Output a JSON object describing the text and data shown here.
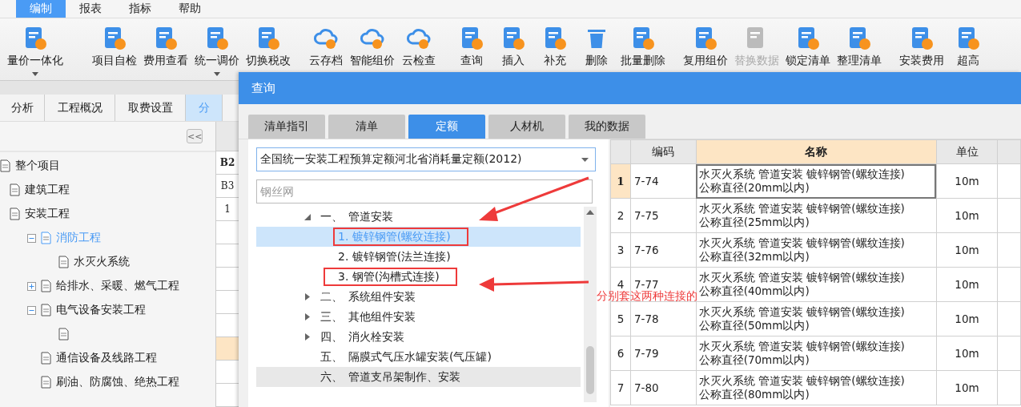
{
  "menu": [
    {
      "label": "编制",
      "selected": true
    },
    {
      "label": "报表",
      "selected": false
    },
    {
      "label": "指标",
      "selected": false
    },
    {
      "label": "帮助",
      "selected": false
    }
  ],
  "toolbar": [
    {
      "label": "量价一体化",
      "has_menu": true,
      "disabled": false
    },
    {
      "label": "项目自检",
      "has_menu": false,
      "disabled": false
    },
    {
      "label": "费用查看",
      "has_menu": false,
      "disabled": false
    },
    {
      "label": "统一调价",
      "has_menu": true,
      "disabled": false
    },
    {
      "label": "切换税改",
      "has_menu": false,
      "disabled": false
    },
    {
      "label": "云存档",
      "has_menu": false,
      "disabled": false
    },
    {
      "label": "智能组价",
      "has_menu": false,
      "disabled": false
    },
    {
      "label": "云检查",
      "has_menu": false,
      "disabled": false
    },
    {
      "label": "查询",
      "has_menu": false,
      "disabled": false
    },
    {
      "label": "插入",
      "has_menu": false,
      "disabled": false
    },
    {
      "label": "补充",
      "has_menu": false,
      "disabled": false
    },
    {
      "label": "删除",
      "has_menu": false,
      "disabled": false
    },
    {
      "label": "批量删除",
      "has_menu": false,
      "disabled": false
    },
    {
      "label": "复用组价",
      "has_menu": false,
      "disabled": false
    },
    {
      "label": "替换数据",
      "has_menu": false,
      "disabled": true
    },
    {
      "label": "锁定清单",
      "has_menu": false,
      "disabled": false
    },
    {
      "label": "整理清单",
      "has_menu": false,
      "disabled": false
    },
    {
      "label": "安装费用",
      "has_menu": false,
      "disabled": false
    },
    {
      "label": "超高",
      "has_menu": false,
      "disabled": false
    }
  ],
  "main_tabs": [
    {
      "label": "分析",
      "selected": false
    },
    {
      "label": "工程概况",
      "selected": false
    },
    {
      "label": "取费设置",
      "selected": false
    },
    {
      "label": "分",
      "selected": true
    }
  ],
  "collapse_button": "<<",
  "project_tree": [
    {
      "label": "整个项目",
      "selected": false,
      "children": [
        {
          "label": "建筑工程",
          "selected": false
        },
        {
          "label": "安装工程",
          "selected": false,
          "children": [
            {
              "label": "消防工程",
              "selected": true,
              "expanded": true,
              "children": [
                {
                  "label": "水灭火系统",
                  "selected": false
                }
              ]
            },
            {
              "label": "给排水、采暖、燃气工程",
              "selected": false,
              "expanded": false
            },
            {
              "label": "电气设备安装工程",
              "selected": false,
              "expanded": true,
              "children": [
                {
                  "selected": false
                }
              ]
            },
            {
              "label": "通信设备及线路工程",
              "selected": false
            },
            {
              "label": "刷油、防腐蚀、绝热工程",
              "selected": false
            }
          ]
        }
      ]
    }
  ],
  "side_column": [
    {
      "text": "B2",
      "bold": true
    },
    {
      "text": "B3",
      "bold": false
    },
    {
      "text": "1",
      "bold": false
    }
  ],
  "dialog": {
    "title": "查询",
    "tabs": [
      {
        "label": "清单指引",
        "selected": false
      },
      {
        "label": "清单",
        "selected": false
      },
      {
        "label": "定额",
        "selected": true
      },
      {
        "label": "人材机",
        "selected": false
      },
      {
        "label": "我的数据",
        "selected": false
      }
    ],
    "library": "全国统一安装工程预算定额河北省消耗量定额(2012)",
    "search": {
      "placeholder": "钢丝网"
    },
    "tree": [
      {
        "number": "一、",
        "label": "管道安装",
        "expanded": true,
        "hovered": false,
        "children": [
          {
            "label": "1. 镀锌钢管(螺纹连接)",
            "selected": true,
            "boxed": true
          },
          {
            "label": "2. 镀锌钢管(法兰连接)",
            "selected": false,
            "boxed": false
          },
          {
            "label": "3. 钢管(沟槽式连接)",
            "selected": false,
            "boxed": true
          }
        ]
      },
      {
        "number": "二、",
        "label": "系统组件安装",
        "expanded": false,
        "hovered": false
      },
      {
        "number": "三、",
        "label": "其他组件安装",
        "expanded": false,
        "hovered": false
      },
      {
        "number": "四、",
        "label": "消火栓安装",
        "expanded": false,
        "hovered": false
      },
      {
        "number": "五、",
        "label": "隔膜式气压水罐安装(气压罐)",
        "hovered": false
      },
      {
        "number": "六、",
        "label": "管道支吊架制作、安装",
        "hovered": true
      }
    ],
    "table": {
      "columns": [
        {
          "label": "编码",
          "selected": false
        },
        {
          "label": "名称",
          "selected": true
        },
        {
          "label": "单位",
          "selected": false
        }
      ],
      "rows": [
        {
          "no": "1",
          "code": "7-74",
          "name": [
            "水灭火系统 管道安装 镀锌钢管(螺纹连接)",
            "公称直径(20mm以内)"
          ],
          "unit": "10m",
          "selected": true
        },
        {
          "no": "2",
          "code": "7-75",
          "name": [
            "水灭火系统 管道安装 镀锌钢管(螺纹连接)",
            "公称直径(25mm以内)"
          ],
          "unit": "10m",
          "selected": false
        },
        {
          "no": "3",
          "code": "7-76",
          "name": [
            "水灭火系统 管道安装 镀锌钢管(螺纹连接)",
            "公称直径(32mm以内)"
          ],
          "unit": "10m",
          "selected": false
        },
        {
          "no": "4",
          "code": "7-77",
          "name": [
            "水灭火系统 管道安装 镀锌钢管(螺纹连接)",
            "公称直径(40mm以内)"
          ],
          "unit": "10m",
          "selected": false
        },
        {
          "no": "5",
          "code": "7-78",
          "name": [
            "水灭火系统 管道安装 镀锌钢管(螺纹连接)",
            "公称直径(50mm以内)"
          ],
          "unit": "10m",
          "selected": false
        },
        {
          "no": "6",
          "code": "7-79",
          "name": [
            "水灭火系统 管道安装 镀锌钢管(螺纹连接)",
            "公称直径(70mm以内)"
          ],
          "unit": "10m",
          "selected": false
        },
        {
          "no": "7",
          "code": "7-80",
          "name": [
            "水灭火系统 管道安装 镀锌钢管(螺纹连接)",
            "公称直径(80mm以内)"
          ],
          "unit": "10m",
          "selected": false
        }
      ]
    }
  },
  "annotation": {
    "text": "分别套这两种连接的"
  }
}
